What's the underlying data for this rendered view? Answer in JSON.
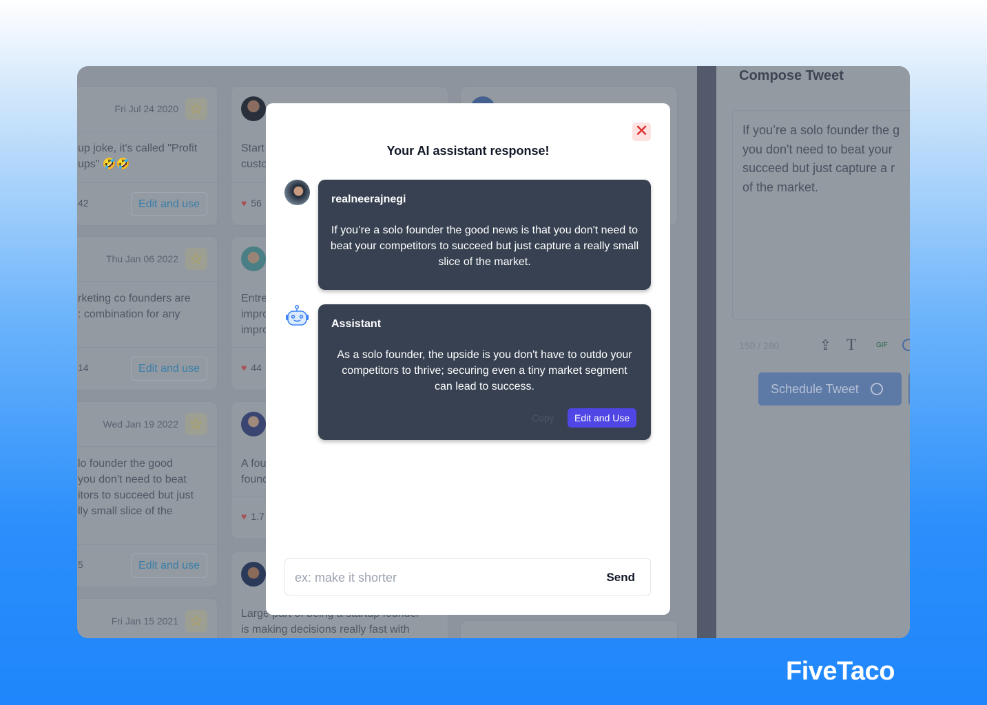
{
  "brand": "FiveTaco",
  "feed": {
    "col1": [
      {
        "date": "Fri Jul 24 2020",
        "text": "up joke, it's called \"Profit\nups\" 🤣🤣",
        "likes": "42",
        "edit": "Edit and use"
      },
      {
        "date": "Thu Jan 06 2022",
        "text": "rketing co founders are\n: combination for any",
        "likes": "14",
        "edit": "Edit and use"
      },
      {
        "date": "Wed Jan 19 2022",
        "text": "lo founder the good\nyou don't need to beat\nitors to succeed but just\nlly small slice of the",
        "likes": "5",
        "edit": "Edit and use"
      },
      {
        "date": "Fri Jan 15 2021"
      }
    ],
    "col2": [
      {
        "text": "Start\ncusto",
        "likes": "56"
      },
      {
        "text": "Entre\nimpro\nimpro",
        "likes": "44"
      },
      {
        "text": "A fou\nfound",
        "likes": "1.7"
      },
      {
        "text": "Large part of being a startup founder\nis making decisions really fast with"
      }
    ]
  },
  "compose": {
    "title": "Compose Tweet",
    "text": "If you’re a solo founder the g\nyou don't need to beat your\nsucceed but just capture a r\nof the market.",
    "counter": "150 / 280",
    "gif": "GIF",
    "schedule": "Schedule Tweet"
  },
  "modal": {
    "title": "Your AI assistant response!",
    "user": {
      "name": "realneerajnegi",
      "text": "If you’re a solo founder the good news is that you don't need to beat your competitors to succeed but just capture a really small slice of the market."
    },
    "assistant": {
      "name": "Assistant",
      "text": "As a solo founder, the upside is you don't have to outdo your competitors to thrive; securing even a tiny market segment can lead to success.",
      "copy": "Copy",
      "edit_use": "Edit and Use"
    },
    "input_placeholder": "ex: make it shorter",
    "send": "Send",
    "accent": "#4f46e5",
    "close_color": "#dc2626"
  }
}
